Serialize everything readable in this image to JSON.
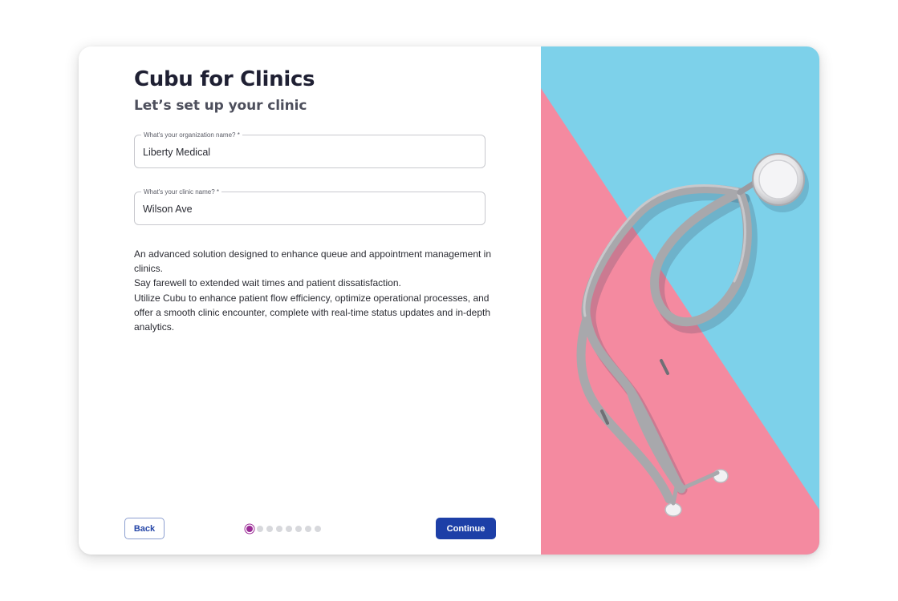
{
  "app": {
    "title": "Cubu for Clinics",
    "subtitle": "Let’s set up your clinic"
  },
  "form": {
    "org_field": {
      "label": "What's your organization name? *",
      "value": "Liberty Medical"
    },
    "clinic_field": {
      "label": "What's your clinic name? *",
      "value": "Wilson Ave"
    }
  },
  "description": {
    "line1": "An advanced solution designed to enhance queue and appointment management in clinics.",
    "line2": "Say farewell to extended wait times and patient dissatisfaction.",
    "line3": "Utilize Cubu to enhance patient flow efficiency, optimize operational processes, and offer a smooth clinic encounter, complete with real-time status updates and in-depth analytics."
  },
  "footer": {
    "back_label": "Back",
    "continue_label": "Continue",
    "steps_total": 8,
    "current_step": 1
  },
  "image": {
    "subject": "stethoscope-illustration",
    "colors": {
      "blue": "#7dd1ea",
      "pink": "#f48aa0",
      "tube": "#a8a8ac"
    }
  },
  "colors": {
    "primary": "#1d3fa7",
    "step_active": "#9b2c96",
    "step_inactive": "#d7d8dc"
  }
}
